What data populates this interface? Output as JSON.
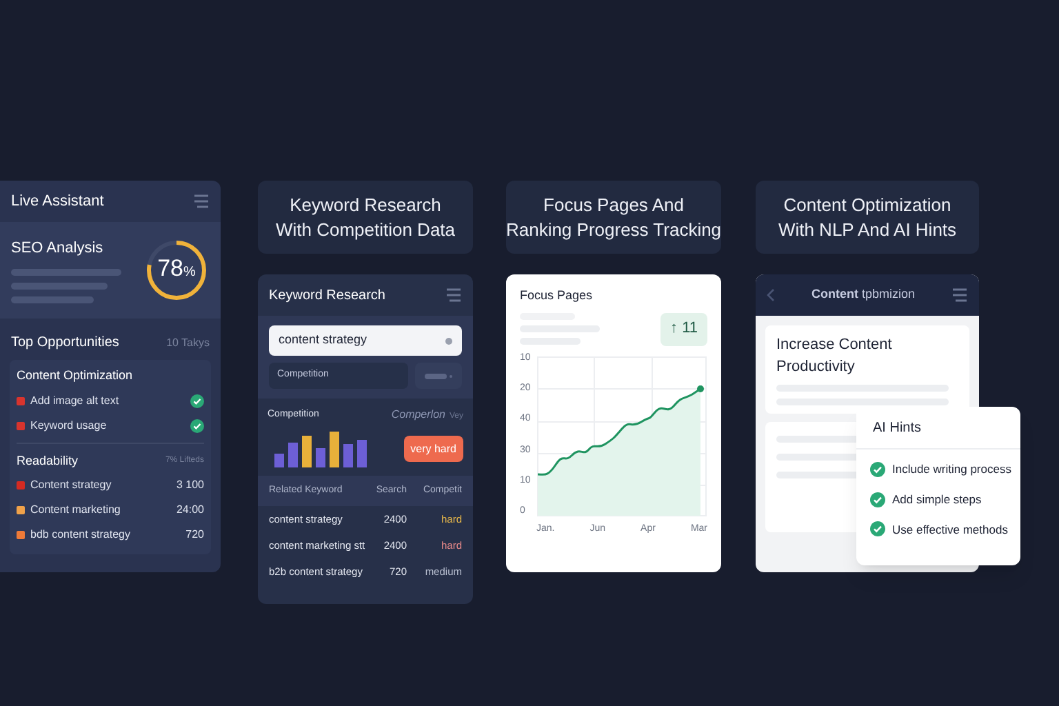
{
  "live_assistant": {
    "title": "Live Assistant",
    "seo": {
      "title": "SEO Analysis",
      "score": "78",
      "unit": "%",
      "level": 0.78
    },
    "opportunities": {
      "title": "Top Opportunities",
      "count": "10 Takys",
      "groups": [
        {
          "title": "Content Optimization",
          "items": [
            {
              "kind": "check",
              "label": "Add image alt text",
              "color": "#d8342e",
              "checked": true
            },
            {
              "kind": "check",
              "label": "Keyword usage",
              "color": "#d8342e",
              "checked": true
            }
          ]
        },
        {
          "title": "Readability",
          "note": "7% Lifteds",
          "items": [
            {
              "kind": "value",
              "label": "Content strategy",
              "color": "#d42a22",
              "value": "3 100"
            },
            {
              "kind": "value",
              "label": "Content marketing",
              "color": "#f0a24a",
              "value": "24:00"
            },
            {
              "kind": "value",
              "label": "bdb content strategy",
              "color": "#ee7a38",
              "value": "720"
            }
          ]
        }
      ]
    }
  },
  "keyword_research": {
    "heading": [
      "Keyword Research",
      "With Competition Data"
    ],
    "title": "Keyword Research",
    "search": {
      "value": "content strategy"
    },
    "filter": {
      "value": "Competition"
    },
    "competition": {
      "title": "Competition",
      "subtitle": "Comperlon",
      "note": "Vey",
      "badge": "very hard"
    },
    "table": {
      "columns": [
        "Related Keyword",
        "Search",
        "Competit"
      ],
      "rows": [
        {
          "keyword": "content strategy",
          "search": "2400",
          "competition": "hard",
          "color": "#e8b84a"
        },
        {
          "keyword": "content marketing stt",
          "search": "2400",
          "competition": "hard",
          "color": "#e88a8a"
        },
        {
          "keyword": "b2b content strategy",
          "search": "720",
          "competition": "medium",
          "color": "#b8bfd0"
        }
      ]
    }
  },
  "focus_pages": {
    "heading": [
      "Focus Pages And",
      "Ranking Progress Tracking"
    ],
    "title": "Focus Pages",
    "badge": "↑ 11",
    "y_labels": [
      "10",
      "20",
      "40",
      "30",
      "10",
      "0"
    ],
    "x_labels": [
      "Jan.",
      "Jun",
      "Apr",
      "Mar"
    ]
  },
  "content_optimization": {
    "heading": [
      "Content Optimization",
      "With NLP And AI Hints"
    ],
    "title": "**Content** tpbmizion",
    "card_title": "Increase Content Productivity",
    "hints": {
      "title": "AI Hints",
      "items": [
        {
          "label": "Include writing process",
          "checked": true
        },
        {
          "label": "Add simple steps",
          "checked": true
        },
        {
          "label": "Use effective methods",
          "checked": true
        }
      ]
    }
  }
}
